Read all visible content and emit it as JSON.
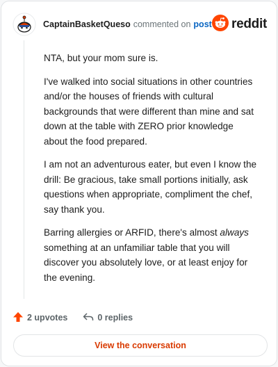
{
  "header": {
    "username": "CaptainBasketQueso",
    "commented_text": "commented on",
    "post_link": "post",
    "brand": "reddit"
  },
  "comment": {
    "p1": "NTA, but your mom sure is.",
    "p2": "I've walked into social situations in other countries and/or the houses of friends with cultural backgrounds that were different than mine and sat down at the table with ZERO prior knowledge about the food prepared.",
    "p3": "I am not an adventurous eater, but even I know the drill: Be gracious, take small portions initially, ask questions when appropriate, compliment the chef, say thank you.",
    "p4_before": "Barring allergies or ARFID, there's almost ",
    "p4_em": "always",
    "p4_after": " something at an unfamiliar table that you will discover you absolutely love, or at least enjoy for the evening."
  },
  "actions": {
    "upvotes": "2 upvotes",
    "replies": "0 replies",
    "view_conversation": "View the conversation"
  },
  "colors": {
    "accent": "#d93a00",
    "link": "#0a66c2",
    "upvote": "#ff4500"
  },
  "icons": [
    "snoo-avatar-icon",
    "reddit-logo-icon",
    "upvote-arrow-icon",
    "reply-arrow-icon"
  ]
}
